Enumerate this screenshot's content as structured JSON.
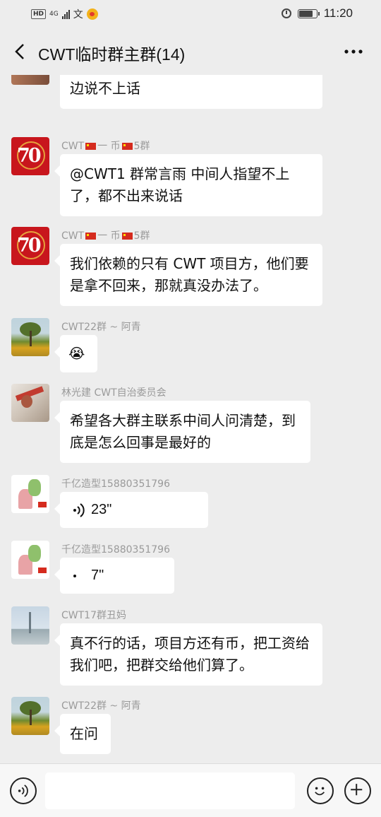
{
  "status_bar": {
    "network_badge": "HD",
    "signal_label": "4G",
    "ime_label": "文",
    "time": "11:20",
    "icons": [
      "signal-icon",
      "weibo-icon",
      "alarm-icon",
      "battery-icon"
    ]
  },
  "header": {
    "title": "CWT临时群主群(14)",
    "icons": [
      "back-icon",
      "more-icon"
    ]
  },
  "messages": [
    {
      "sender": "",
      "text": "毕竟不是我们群主直接联系，交易所哪边说不上话",
      "type": "text",
      "avatar": "partial-photo"
    },
    {
      "sender_parts": [
        "CWT",
        "一 币",
        "5群"
      ],
      "text": "@CWT1 群常言雨  中间人指望不上了，都不出来说话",
      "type": "text",
      "avatar": "70-anniversary-logo"
    },
    {
      "sender_parts": [
        "CWT",
        "一 币",
        "5群"
      ],
      "text": "我们依赖的只有 CWT 项目方，他们要是拿不回来，那就真没办法了。",
      "type": "text",
      "avatar": "70-anniversary-logo"
    },
    {
      "sender": "CWT22群 ~ 阿青",
      "text": "",
      "type": "emoji",
      "emoji": "😭",
      "avatar": "tree-field-photo"
    },
    {
      "sender": "林光建 CWT自治委员会",
      "text": "希望各大群主联系中间人问清楚，到底是怎么回事是最好的",
      "type": "text",
      "avatar": "person-photo"
    },
    {
      "sender": "千亿造型15880351796",
      "type": "voice",
      "duration": "23\"",
      "avatar": "cartoon-couple"
    },
    {
      "sender": "千亿造型15880351796",
      "type": "voice",
      "duration": "7\"",
      "avatar": "cartoon-couple"
    },
    {
      "sender": "CWT17群丑妈",
      "text": "真不行的话，项目方还有币，把工资给我们吧，把群交给他们算了。",
      "type": "text",
      "avatar": "tower-photo"
    },
    {
      "sender": "CWT22群 ~ 阿青",
      "text": "在问",
      "type": "text",
      "avatar": "tree-field-photo"
    }
  ],
  "input_bar": {
    "value": "",
    "placeholder": "",
    "icons": [
      "voice-input-icon",
      "emoji-icon",
      "plus-icon"
    ]
  },
  "colors": {
    "background": "#ededed",
    "bubble": "#ffffff",
    "sender_name": "#9a9a9a",
    "flag_red": "#d52b1e"
  }
}
